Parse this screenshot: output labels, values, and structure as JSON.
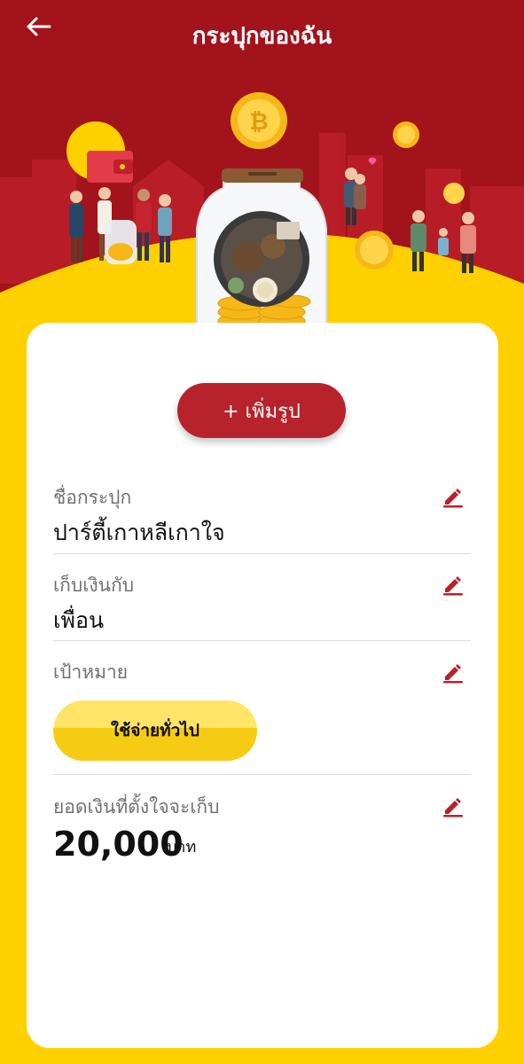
{
  "header": {
    "title": "กระปุกของฉัน"
  },
  "add_photo_label": "+ เพิ่มรูป",
  "fields": {
    "jar_name": {
      "label": "ชื่อกระปุก",
      "value": "ปาร์ตี้เกาหลีเกาใจ"
    },
    "save_with": {
      "label": "เก็บเงินกับ",
      "value": "เพื่อน"
    },
    "goal": {
      "label": "เป้าหมาย",
      "chip": "ใช้จ่ายทั่วไป"
    },
    "target_amount": {
      "label": "ยอดเงินที่ตั้งใจจะเก็บ",
      "value": "20,000",
      "unit": "บาท"
    }
  },
  "colors": {
    "brand_red": "#b8222b",
    "header_red": "#a3131c",
    "yellow": "#ffd000",
    "chip_yellow": "#f6cb14"
  }
}
